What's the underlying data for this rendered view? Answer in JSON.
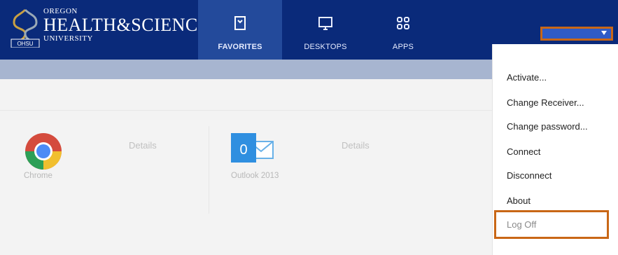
{
  "header": {
    "logo": {
      "line1": "OREGON",
      "line2": "HEALTH&SCIENCE",
      "line3": "UNIVERSITY",
      "badge": "OHSU"
    },
    "tabs": [
      {
        "label": "FAVORITES",
        "icon": "favorites-bookmark-icon",
        "active": true
      },
      {
        "label": "DESKTOPS",
        "icon": "desktop-monitor-icon",
        "active": false
      },
      {
        "label": "APPS",
        "icon": "apps-grid-icon",
        "active": false
      }
    ],
    "user_button": {
      "label": "",
      "icon": "chevron-down-icon"
    }
  },
  "apps": [
    {
      "name": "Chrome",
      "details_label": "Details",
      "icon": "chrome-icon"
    },
    {
      "name": "Outlook 2013",
      "details_label": "Details",
      "icon": "outlook-icon"
    }
  ],
  "menu": {
    "items": [
      {
        "label": "Activate..."
      },
      {
        "label": "Change Receiver..."
      },
      {
        "label": "Change password..."
      },
      {
        "label": "Connect"
      },
      {
        "label": "Disconnect"
      },
      {
        "label": "About"
      },
      {
        "label": "Log Off"
      }
    ]
  },
  "colors": {
    "header_bg": "#0a2a7a",
    "active_tab_bg": "#234a9b",
    "subbar_bg": "#a7b5d0",
    "highlight_border": "#c96716",
    "menu_bg": "#ffffff"
  }
}
